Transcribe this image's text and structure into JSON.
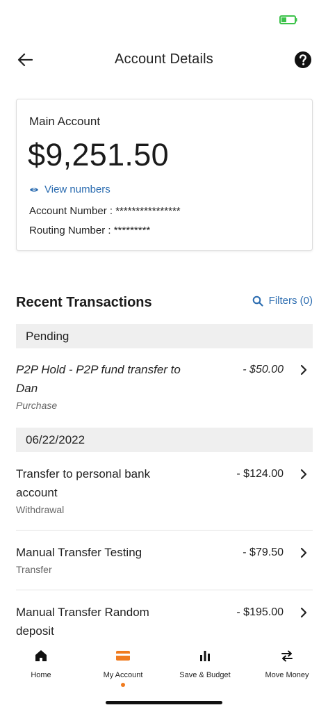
{
  "header": {
    "title": "Account Details"
  },
  "account": {
    "name": "Main Account",
    "balance": "$9,251.50",
    "view_numbers_label": "View numbers",
    "account_number_line": "Account Number : ****************",
    "routing_number_line": "Routing Number : *********"
  },
  "transactions": {
    "title": "Recent Transactions",
    "filters_label": "Filters (0)",
    "groups": [
      {
        "label": "Pending",
        "items": [
          {
            "line1": "P2P Hold - P2P fund transfer to",
            "line2": "Dan",
            "type": "Purchase",
            "amount": "- $50.00"
          }
        ]
      },
      {
        "label": "06/22/2022",
        "items": [
          {
            "line1": "Transfer to personal bank",
            "line2": "account",
            "type": "Withdrawal",
            "amount": "- $124.00"
          },
          {
            "line1": "Manual Transfer Testing",
            "type": "Transfer",
            "amount": "- $79.50"
          },
          {
            "line1": "Manual Transfer Random",
            "line2": "deposit",
            "amount": "- $195.00"
          }
        ]
      }
    ]
  },
  "nav": {
    "items": [
      {
        "label": "Home",
        "icon": "home-icon"
      },
      {
        "label": "My Account",
        "icon": "card-icon",
        "active": true
      },
      {
        "label": "Save & Budget",
        "icon": "bar-chart-icon"
      },
      {
        "label": "Move Money",
        "icon": "transfer-arrows-icon"
      }
    ]
  },
  "colors": {
    "accent": "#f07b1f",
    "link": "#2b6cb0",
    "battery": "#3cc24a"
  }
}
